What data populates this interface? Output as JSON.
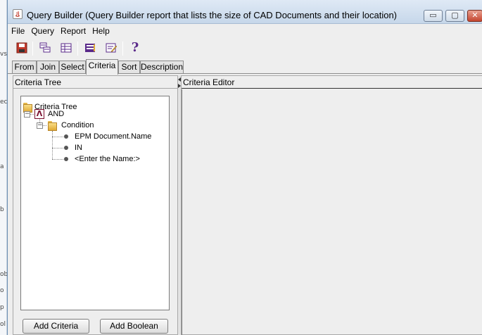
{
  "background": {
    "fragments": [
      "ec",
      "vs",
      "a",
      "b",
      "ob",
      "o",
      "p",
      "ol"
    ]
  },
  "window": {
    "title": "Query Builder (Query Builder report that lists the size of CAD Documents and their location)",
    "min_glyph": "▭",
    "max_glyph": "▢",
    "close_glyph": "✕"
  },
  "menu": {
    "items": [
      "File",
      "Query",
      "Report",
      "Help"
    ]
  },
  "toolbar": {
    "icons": [
      "save-icon",
      "query-icon",
      "table-icon",
      "report-icon",
      "edit-icon",
      "help-icon"
    ],
    "help_glyph": "?"
  },
  "tabs": {
    "items": [
      "From",
      "Join",
      "Select",
      "Criteria",
      "Sort",
      "Description"
    ],
    "active": "Criteria"
  },
  "criteria_tree": {
    "header": "Criteria Tree",
    "root": "Criteria Tree",
    "boolean_label": "AND",
    "boolean_glyph": "Λ",
    "condition_label": "Condition",
    "condition_items": [
      "EPM Document.Name",
      "IN",
      "<Enter the Name:>"
    ],
    "expander_glyph": "−"
  },
  "criteria_editor": {
    "header": "Criteria Editor"
  },
  "buttons": {
    "add_criteria": "Add Criteria",
    "add_boolean": "Add Boolean"
  },
  "colors": {
    "title_bar": "#c6d7ea",
    "accent_purple": "#5a2a8a",
    "save_red": "#c0392b"
  }
}
